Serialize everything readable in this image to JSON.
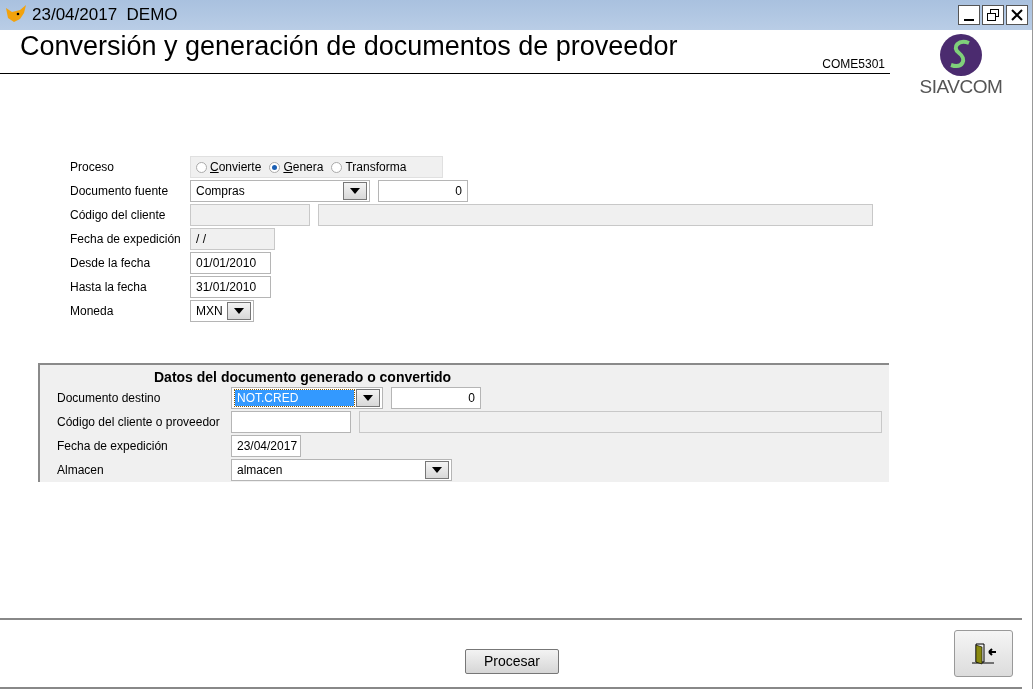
{
  "window": {
    "title": "23/04/2017  DEMO"
  },
  "header": {
    "title": "Conversión y generación de documentos de proveedor",
    "code": "COME5301",
    "logo_text": "SIAVCOM"
  },
  "form": {
    "rows": [
      {
        "label": "Proceso",
        "kind": "radio",
        "options": [
          {
            "label": "Convierte",
            "selected": false,
            "mnemonic": true
          },
          {
            "label": "Genera",
            "selected": true,
            "mnemonic": true
          },
          {
            "label": "Transforma",
            "selected": false,
            "mnemonic": false
          }
        ]
      },
      {
        "label": "Documento fuente",
        "kind": "fields",
        "controls": [
          {
            "kind": "combo",
            "value": "Compras",
            "disabled": false,
            "focused": false
          },
          {
            "kind": "number",
            "value": "0",
            "disabled": false
          }
        ]
      },
      {
        "label": "Código del cliente",
        "kind": "fields",
        "controls": [
          {
            "kind": "text",
            "disabled": true
          },
          {
            "kind": "text",
            "disabled": true
          }
        ]
      },
      {
        "label": "Fecha de expedición",
        "kind": "fields",
        "controls": [
          {
            "kind": "text",
            "value": "/ /",
            "disabled": true
          }
        ]
      },
      {
        "label": "Desde la fecha",
        "kind": "fields",
        "controls": [
          {
            "kind": "text",
            "value": "01/01/2010",
            "disabled": false
          }
        ]
      },
      {
        "label": "Hasta la fecha",
        "kind": "fields",
        "controls": [
          {
            "kind": "text",
            "value": "31/01/2010",
            "disabled": false
          }
        ]
      },
      {
        "label": "Moneda",
        "kind": "fields",
        "controls": [
          {
            "kind": "combo",
            "value": "MXN",
            "disabled": false,
            "focused": false
          }
        ]
      }
    ]
  },
  "panel": {
    "title": "Datos del documento generado o convertido",
    "rows": [
      {
        "label": "Documento destino",
        "kind": "fields",
        "controls": [
          {
            "kind": "combo",
            "value": "NOT.CRED",
            "disabled": false,
            "focused": true
          },
          {
            "kind": "number",
            "value": "0",
            "disabled": false
          }
        ]
      },
      {
        "label": "Código del cliente o proveedor",
        "kind": "fields",
        "controls": [
          {
            "kind": "text",
            "disabled": false
          },
          {
            "kind": "text",
            "disabled": true
          }
        ]
      },
      {
        "label": "Fecha de expedición",
        "kind": "fields",
        "controls": [
          {
            "kind": "text",
            "value": "23/04/2017",
            "disabled": false
          }
        ]
      },
      {
        "label": "Almacen",
        "kind": "fields",
        "controls": [
          {
            "kind": "combo",
            "value": "almacen",
            "disabled": false,
            "focused": false
          }
        ]
      }
    ]
  },
  "buttons": {
    "process": "Procesar"
  }
}
